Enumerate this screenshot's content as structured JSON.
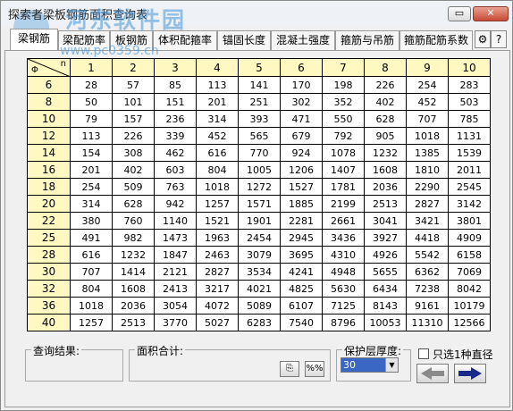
{
  "window": {
    "title": "探索者梁板钢筋面积查询表",
    "watermark": "河东软件园",
    "watermark_url": "www.pc0359.cn",
    "min_label": "▭",
    "close_label": "✕"
  },
  "tabs": [
    {
      "label": "梁钢筋"
    },
    {
      "label": "梁配筋率"
    },
    {
      "label": "板钢筋"
    },
    {
      "label": "体积配箍率"
    },
    {
      "label": "锚固长度"
    },
    {
      "label": "混凝土强度"
    },
    {
      "label": "箍筋与吊筋"
    },
    {
      "label": "箍筋配筋系数"
    }
  ],
  "table": {
    "corner_n": "n",
    "corner_phi": "Φ",
    "columns": [
      "1",
      "2",
      "3",
      "4",
      "5",
      "6",
      "7",
      "8",
      "9",
      "10"
    ],
    "rows": [
      {
        "d": "6",
        "v": [
          "28",
          "57",
          "85",
          "113",
          "141",
          "170",
          "198",
          "226",
          "254",
          "283"
        ]
      },
      {
        "d": "8",
        "v": [
          "50",
          "101",
          "151",
          "201",
          "251",
          "302",
          "352",
          "402",
          "452",
          "503"
        ]
      },
      {
        "d": "10",
        "v": [
          "79",
          "157",
          "236",
          "314",
          "393",
          "471",
          "550",
          "628",
          "707",
          "785"
        ]
      },
      {
        "d": "12",
        "v": [
          "113",
          "226",
          "339",
          "452",
          "565",
          "679",
          "792",
          "905",
          "1018",
          "1131"
        ]
      },
      {
        "d": "14",
        "v": [
          "154",
          "308",
          "462",
          "616",
          "770",
          "924",
          "1078",
          "1232",
          "1385",
          "1539"
        ]
      },
      {
        "d": "16",
        "v": [
          "201",
          "402",
          "603",
          "804",
          "1005",
          "1206",
          "1407",
          "1608",
          "1810",
          "2011"
        ]
      },
      {
        "d": "18",
        "v": [
          "254",
          "509",
          "763",
          "1018",
          "1272",
          "1527",
          "1781",
          "2036",
          "2290",
          "2545"
        ]
      },
      {
        "d": "20",
        "v": [
          "314",
          "628",
          "942",
          "1257",
          "1571",
          "1885",
          "2199",
          "2513",
          "2827",
          "3142"
        ]
      },
      {
        "d": "22",
        "v": [
          "380",
          "760",
          "1140",
          "1521",
          "1901",
          "2281",
          "2661",
          "3041",
          "3421",
          "3801"
        ]
      },
      {
        "d": "25",
        "v": [
          "491",
          "982",
          "1473",
          "1963",
          "2454",
          "2945",
          "3436",
          "3927",
          "4418",
          "4909"
        ]
      },
      {
        "d": "28",
        "v": [
          "616",
          "1232",
          "1847",
          "2463",
          "3079",
          "3695",
          "4310",
          "4926",
          "5542",
          "6158"
        ]
      },
      {
        "d": "30",
        "v": [
          "707",
          "1414",
          "2121",
          "2827",
          "3534",
          "4241",
          "4948",
          "5655",
          "6362",
          "7069"
        ]
      },
      {
        "d": "32",
        "v": [
          "804",
          "1608",
          "2413",
          "3217",
          "4021",
          "4825",
          "5630",
          "6434",
          "7238",
          "8042"
        ]
      },
      {
        "d": "36",
        "v": [
          "1018",
          "2036",
          "3054",
          "4072",
          "5089",
          "6107",
          "7125",
          "8143",
          "9161",
          "10179"
        ]
      },
      {
        "d": "40",
        "v": [
          "1257",
          "2513",
          "3770",
          "5027",
          "6283",
          "7540",
          "8796",
          "10053",
          "11310",
          "12566"
        ]
      }
    ]
  },
  "bottom": {
    "query_result_label": "查询结果:",
    "area_total_label": "面积合计:",
    "copy_button_label": "⎘",
    "percent_button_label": "%%",
    "cover_label": "保护层厚度:",
    "cover_value": "30",
    "single_dia_label": "只选1种直径",
    "single_dia_checked": false,
    "back_arrow": "◀",
    "forward_arrow": "▶"
  },
  "colors": {
    "header_bg": "#fff8c0",
    "select_highlight": "#3a66c4",
    "forward_arrow": "#1a2a8a",
    "back_arrow": "#8a8a8a"
  }
}
